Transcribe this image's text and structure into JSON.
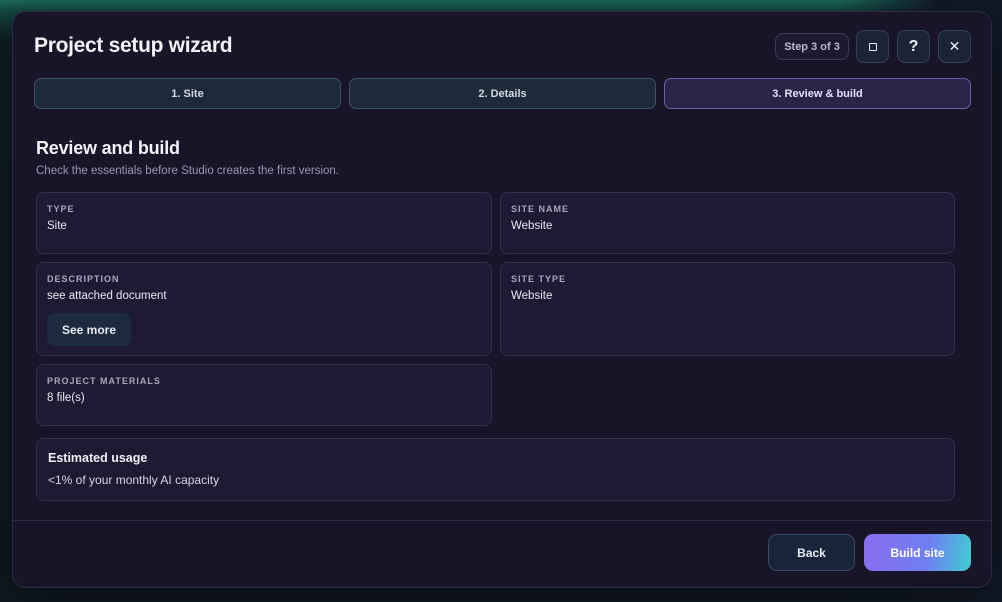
{
  "wizard": {
    "title": "Project setup wizard",
    "step_badge": "Step 3 of 3",
    "help_label": "?",
    "close_label": "✕"
  },
  "steps": [
    {
      "label": "1. Site",
      "active": false
    },
    {
      "label": "2. Details",
      "active": false
    },
    {
      "label": "3. Review & build",
      "active": true
    }
  ],
  "review": {
    "title": "Review and build",
    "subtitle": "Check the essentials before Studio creates the first version.",
    "fields": {
      "type": {
        "label": "TYPE",
        "value": "Site"
      },
      "site_name": {
        "label": "SITE NAME",
        "value": "Website"
      },
      "description": {
        "label": "DESCRIPTION",
        "value": "see attached document",
        "action": "See more"
      },
      "site_type": {
        "label": "SITE TYPE",
        "value": "Website"
      },
      "materials": {
        "label": "PROJECT MATERIALS",
        "value": "8 file(s)"
      }
    },
    "usage": {
      "title": "Estimated usage",
      "text": "<1% of your monthly AI capacity"
    }
  },
  "footer": {
    "back_label": "Back",
    "build_label": "Build site"
  },
  "colors": {
    "dialog_bg": "#181529",
    "card_bg": "#1f1a33",
    "accent_gradient_start": "#8a6cf0",
    "accent_gradient_end": "#3fcfd0",
    "active_step_border": "#6b5fa8"
  }
}
